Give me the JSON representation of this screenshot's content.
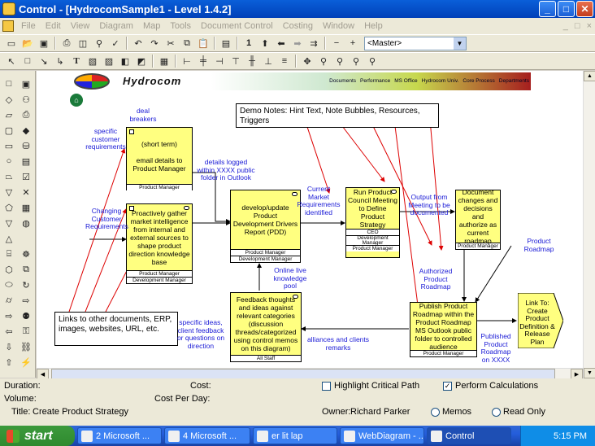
{
  "window": {
    "title": "Control - [HydrocomSample1 - Level 1.4.2]",
    "buttons": {
      "min": "_",
      "max": "□",
      "close": "✕"
    }
  },
  "menu": {
    "items": [
      "File",
      "Edit",
      "View",
      "Diagram",
      "Map",
      "Tools",
      "Document Control",
      "Costing",
      "Window",
      "Help"
    ],
    "mdi": [
      "_",
      "□",
      "×"
    ]
  },
  "toolbar1": {
    "level_number": "1",
    "level_select": "<Master>"
  },
  "header_bar": {
    "brand": "Hydrocom",
    "links": [
      "Documents",
      "Performance",
      "MS Office",
      "Hydrocom Univ.",
      "Core Process",
      "Departments"
    ]
  },
  "diagram": {
    "note_demo": "Demo Notes: Hint Text, Note Bubbles, Resources, Triggers",
    "note_links": "Links to other documents, ERP, images, websites, URL, etc.",
    "nodes": [
      {
        "text": "(short term)\n\nemail details to Product Manager",
        "role": "Product Manager"
      },
      {
        "text": "Proactively gather market intelligence from internal and external sources to shape product direction knowledge base",
        "role": "Product Manager",
        "role2": "Development Manager"
      },
      {
        "text": "develop/update Product Development Drivers Report (PDD)",
        "role": "Product Manager",
        "role2": "Development Manager"
      },
      {
        "text": "Run Product Council Meeting to Define Product Strategy",
        "role": "CEO",
        "role2": "Development Manager",
        "role3": "Product Manager"
      },
      {
        "text": "Document changes and decisions and authorize as current roadmap",
        "role": "Product Manager"
      },
      {
        "text": "Feedback thoughts and ideas against relevant categories (discussion threads/categorized using control memos on this diagram)",
        "role": "All Staff"
      },
      {
        "text": "Publish Product Roadmap within the Product Roadmap MS Outlook public folder to controlled audience",
        "role": "Product Manager"
      },
      {
        "text": "Link To: Create Product Definition & Release Plan"
      }
    ],
    "labels": {
      "deal_breakers": "deal breakers",
      "specific_customer": "specific customer requirements",
      "details_logged": "details logged within XXXX public folder in Outlook",
      "changing_customer": "Changing Customer Requirements",
      "current_market": "Current Market Requirements identified",
      "output_from": "Output from Meeting to be documented",
      "product_roadmap": "Product Roadmap",
      "online_live": "Online live knowledge pool",
      "authorized": "Authorized Product Roadmap",
      "specific_ideas": "specific ideas, client feedback or questions on direction",
      "alliances": "alliances and clients remarks",
      "published": "Published Product Roadmap on XXXX"
    }
  },
  "properties": {
    "duration_label": "Duration:",
    "cost_label": "Cost:",
    "highlight_label": "Highlight Critical Path",
    "perform_label": "Perform Calculations",
    "volume_label": "Volume:",
    "cost_per_day_label": "Cost Per Day:",
    "title_label": "Title:",
    "title_value": "Create Product Strategy",
    "owner_label": "Owner:",
    "owner_value": "Richard Parker",
    "memos_label": "Memos",
    "readonly_label": "Read Only"
  },
  "taskbar": {
    "start": "start",
    "tasks": [
      "2 Microsoft ...",
      "4 Microsoft ...",
      "er lit lap",
      "WebDiagram - ...",
      "Control"
    ],
    "clock": "5:15 PM"
  }
}
